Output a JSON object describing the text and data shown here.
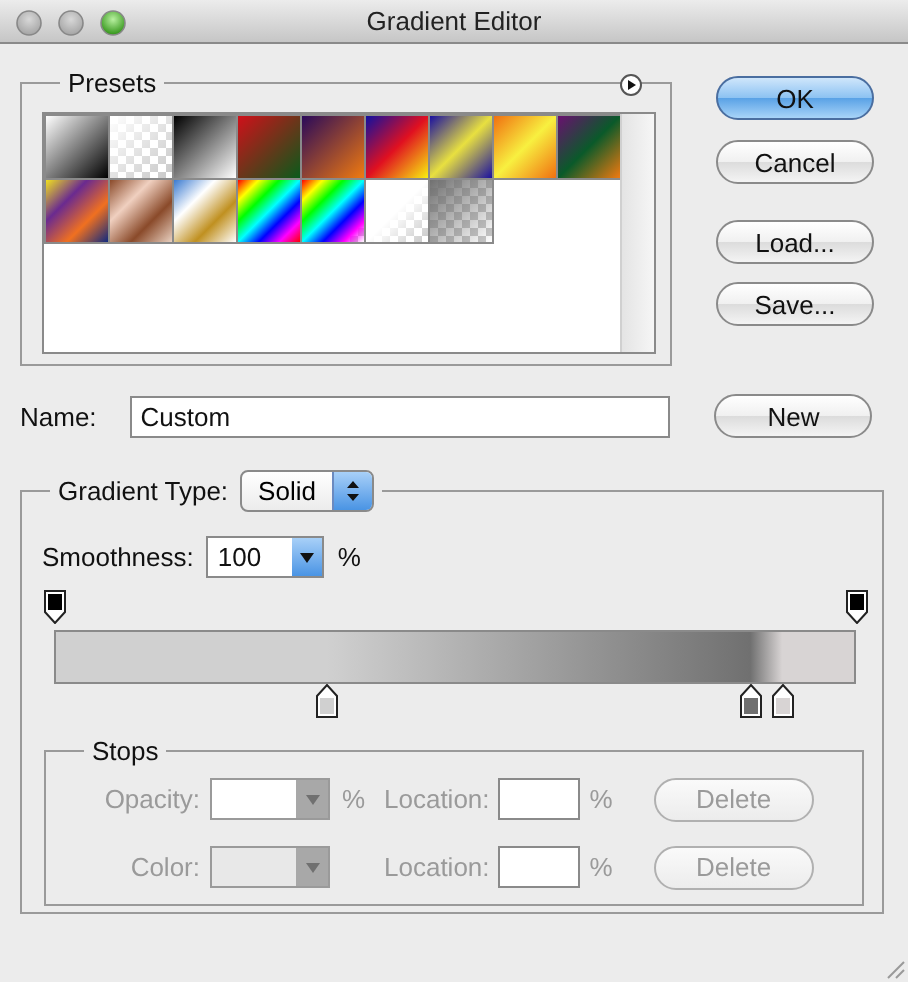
{
  "window": {
    "title": "Gradient Editor"
  },
  "presets": {
    "label": "Presets",
    "items": [
      {
        "kind": "gradient"
      },
      {
        "kind": "fade"
      },
      {
        "kind": "gradient"
      },
      {
        "kind": "gradient"
      },
      {
        "kind": "gradient"
      },
      {
        "kind": "gradient"
      },
      {
        "kind": "gradient"
      },
      {
        "kind": "gradient"
      },
      {
        "kind": "gradient"
      },
      {
        "kind": "gradient"
      },
      {
        "kind": "gradient"
      },
      {
        "kind": "gradient"
      },
      {
        "kind": "gradient"
      },
      {
        "kind": "fade"
      },
      {
        "kind": "fade"
      },
      {
        "kind": "fade"
      }
    ]
  },
  "buttons": [
    {
      "label": "OK",
      "default": true
    },
    {
      "label": "Cancel",
      "default": false
    },
    {
      "label": "Load...",
      "default": false
    },
    {
      "label": "Save...",
      "default": false
    }
  ],
  "name": {
    "label": "Name:",
    "value": "Custom"
  },
  "new_button": {
    "label": "New"
  },
  "gradient": {
    "type_label": "Gradient Type:",
    "type_value": "Solid",
    "smoothness_label": "Smoothness:",
    "smoothness_value": "100",
    "smoothness_unit": "%",
    "opacity_stops": [
      {
        "level": 0
      },
      {
        "level": 1
      }
    ],
    "color_stops": [
      {
        "level": 0.34,
        "color": "#d0d0d0"
      },
      {
        "level": 0.87,
        "color": "#707070"
      },
      {
        "level": 0.91,
        "color": "#d8d4d4"
      }
    ]
  },
  "stops": {
    "label": "Stops",
    "disabled": true,
    "rows": [
      {
        "kind": "opacity",
        "label": "Opacity:",
        "unit": "%",
        "location_label": "Location:",
        "location_unit": "%",
        "delete_label": "Delete"
      },
      {
        "kind": "color",
        "label": "Color:",
        "location_label": "Location:",
        "location_unit": "%",
        "delete_label": "Delete"
      }
    ]
  }
}
